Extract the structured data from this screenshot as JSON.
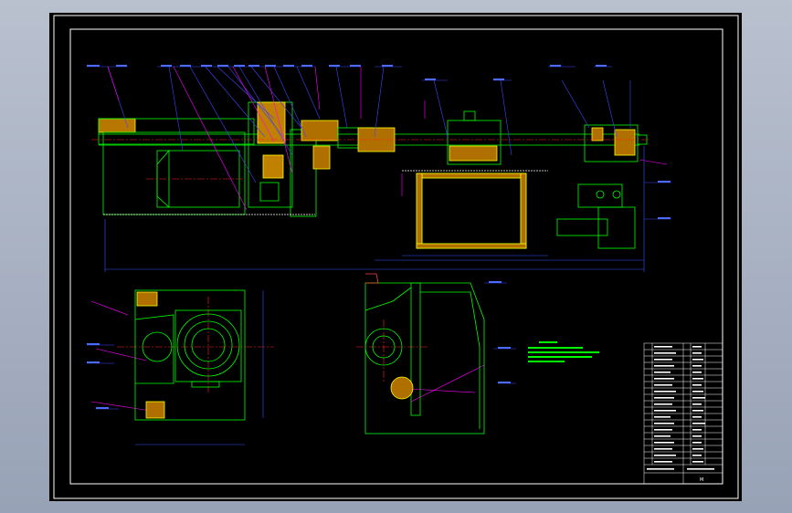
{
  "drawing": {
    "type": "mechanical assembly drawing (CAD)",
    "background": "#000000",
    "colors": {
      "outline": "#00ff00",
      "leader": "#ff00ff",
      "callout": "#4444ff",
      "centerline": "#ff2020",
      "dimension": "#3355ff",
      "hatch": "#ffff00",
      "border": "#ffffff",
      "accent": "#00ffff"
    },
    "title_block_mark": "M"
  }
}
